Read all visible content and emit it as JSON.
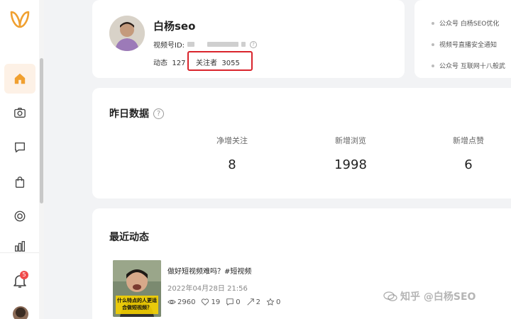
{
  "colors": {
    "accent": "#f0a030",
    "highlight_border": "#d9242c",
    "badge": "#f04a4a"
  },
  "sidebar": {
    "items": [
      {
        "name": "home-icon",
        "active": true
      },
      {
        "name": "camera-icon",
        "active": false
      },
      {
        "name": "message-icon",
        "active": false
      },
      {
        "name": "shopping-bag-icon",
        "active": false
      },
      {
        "name": "target-icon",
        "active": false
      },
      {
        "name": "bar-chart-icon",
        "active": false
      }
    ],
    "notification_count": "5"
  },
  "profile": {
    "name": "白杨seo",
    "id_label": "视频号ID:",
    "posts_label": "动态",
    "posts_count": "127",
    "followers_label": "关注者",
    "followers_count": "3055"
  },
  "notices": [
    "公众号 白杨SEO优化",
    "视频号直播安全通知",
    "公众号 互联网十八般武"
  ],
  "stats": {
    "title": "昨日数据",
    "items": [
      {
        "label": "净增关注",
        "value": "8"
      },
      {
        "label": "新增浏览",
        "value": "1998"
      },
      {
        "label": "新增点赞",
        "value": "6"
      }
    ]
  },
  "recent": {
    "title": "最近动态",
    "post": {
      "title": "做好短视频难吗？#短视频",
      "date": "2022年04月28日 21:56",
      "thumb_caption": "什么特点的人更适合做短视频？",
      "views": "2960",
      "likes": "19",
      "comments": "0",
      "shares": "2",
      "favorites": "0"
    }
  },
  "watermark": "知乎 @白杨SEO"
}
